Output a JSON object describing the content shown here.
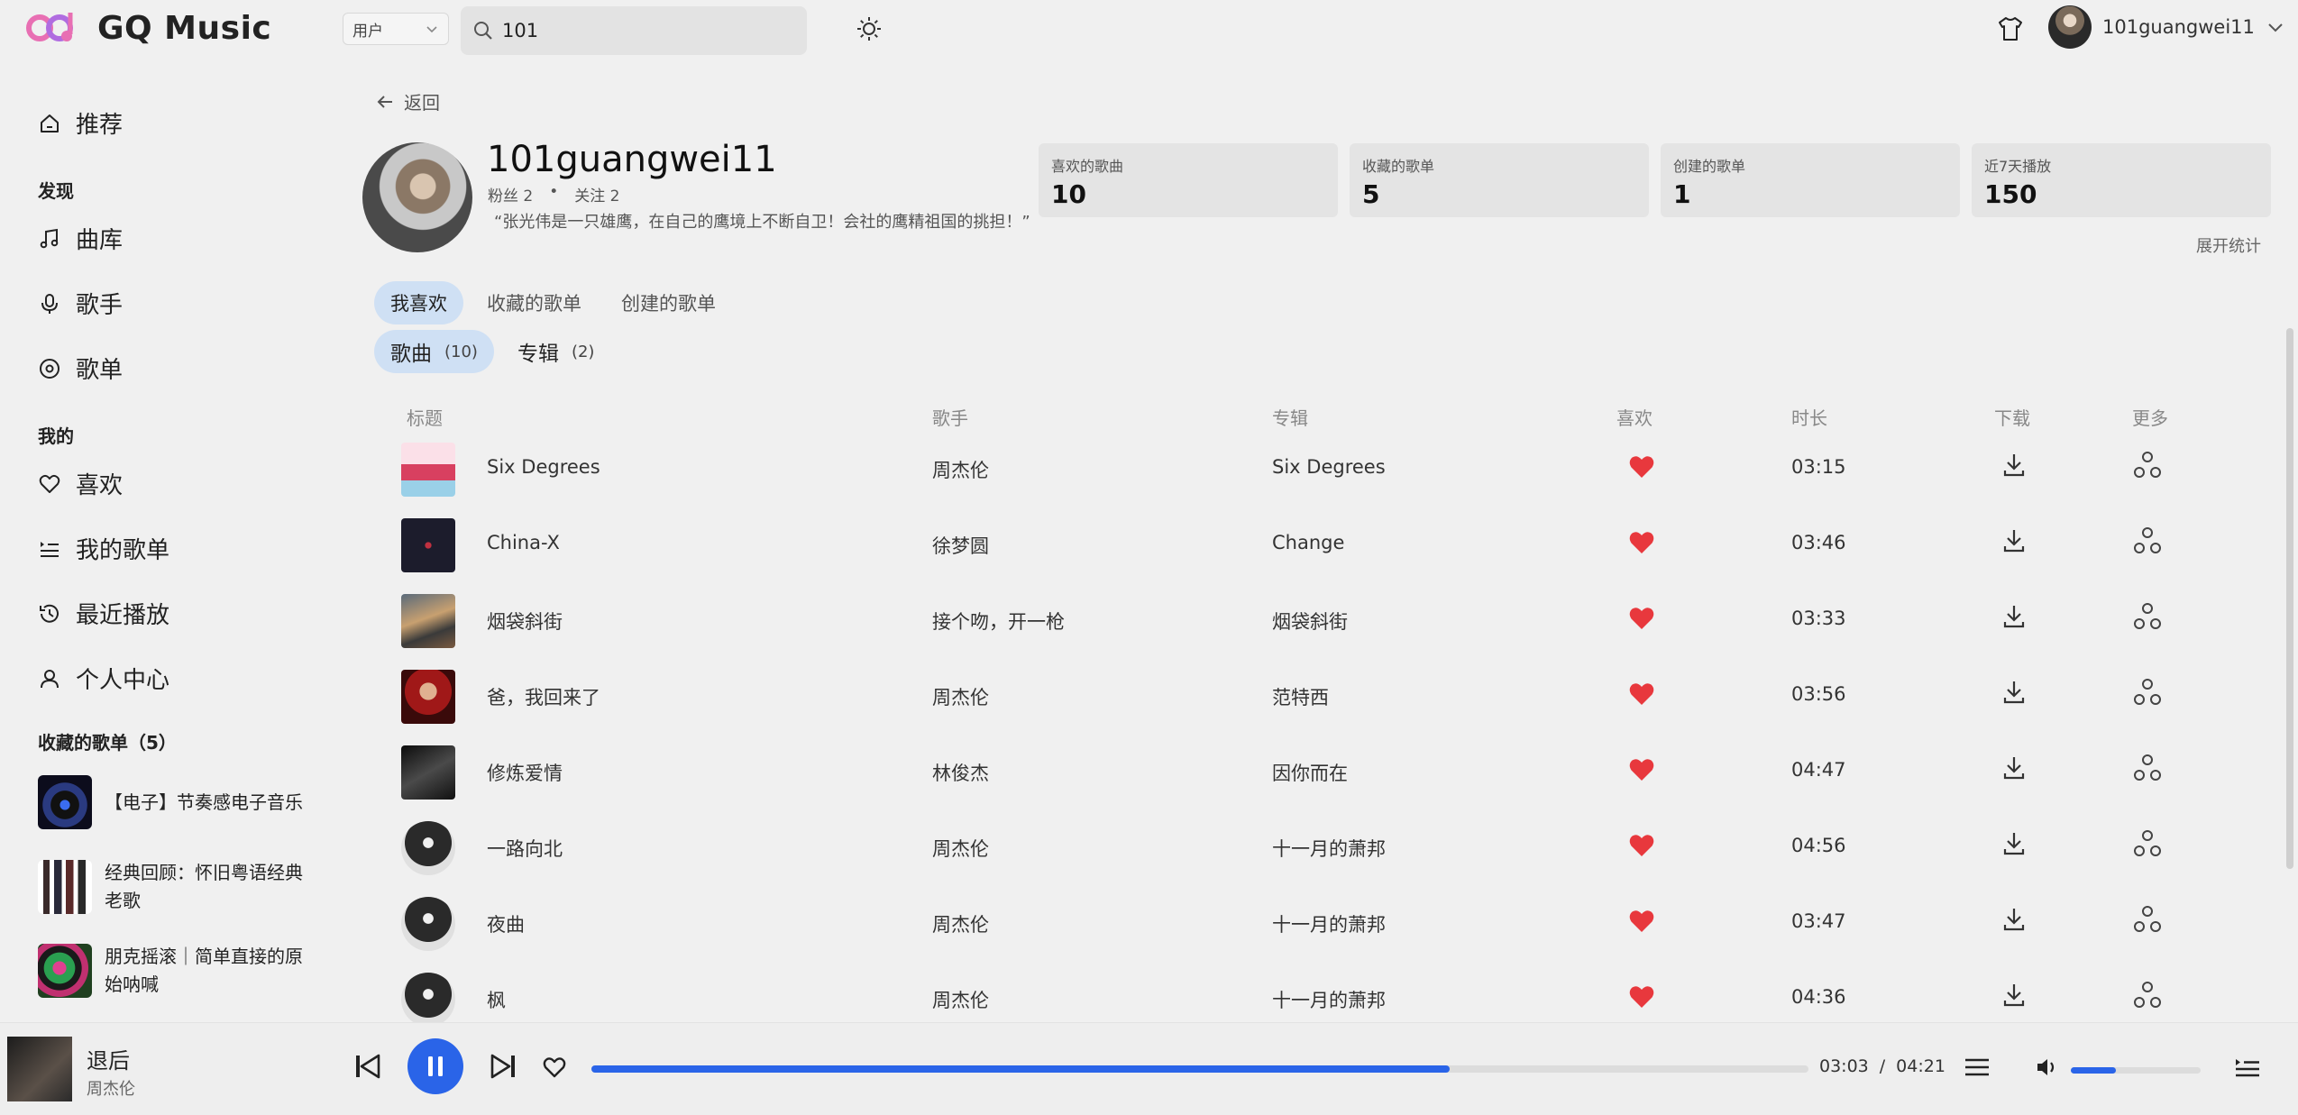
{
  "app": {
    "name": "GQ Music"
  },
  "header": {
    "search_type": "用户",
    "search_value": "101",
    "user_name": "101guangwei11"
  },
  "sidebar": {
    "recommend": "推荐",
    "discover_title": "发现",
    "discover_items": [
      "曲库",
      "歌手",
      "歌单"
    ],
    "mine_title": "我的",
    "mine_items": [
      "喜欢",
      "我的歌单",
      "最近播放",
      "个人中心"
    ],
    "collected_title": "收藏的歌单（5）",
    "collected": [
      {
        "title": "【电子】节奏感电子音乐"
      },
      {
        "title": "经典回顾：怀旧粤语经典老歌"
      },
      {
        "title": "朋克摇滚｜简单直接的原始呐喊"
      }
    ]
  },
  "profile": {
    "back_label": "返回",
    "name": "101guangwei11",
    "fans": "粉丝 2",
    "separator": "•",
    "follows": "关注 2",
    "signature": "“张光伟是一只雄鹰，在自己的鹰境上不断自卫！会社的鹰精祖国的挑担！”",
    "stats": [
      {
        "label": "喜欢的歌曲",
        "value": "10"
      },
      {
        "label": "收藏的歌单",
        "value": "5"
      },
      {
        "label": "创建的歌单",
        "value": "1"
      },
      {
        "label": "近7天播放",
        "value": "150"
      }
    ],
    "expand_stats": "展开统计"
  },
  "tabs": [
    "我喜欢",
    "收藏的歌单",
    "创建的歌单"
  ],
  "subtabs": [
    {
      "label": "歌曲",
      "count": "(10)"
    },
    {
      "label": "专辑",
      "count": "(2)"
    }
  ],
  "table": {
    "headers": {
      "title": "标题",
      "artist": "歌手",
      "album": "专辑",
      "like": "喜欢",
      "duration": "时长",
      "download": "下载",
      "more": "更多"
    },
    "rows": [
      {
        "title": "Six Degrees",
        "artist": "周杰伦",
        "album": "Six Degrees",
        "duration": "03:15"
      },
      {
        "title": "China-X",
        "artist": "徐梦圆",
        "album": "Change",
        "duration": "03:46"
      },
      {
        "title": "烟袋斜街",
        "artist": "接个吻，开一枪",
        "album": "烟袋斜街",
        "duration": "03:33"
      },
      {
        "title": "爸，我回来了",
        "artist": "周杰伦",
        "album": "范特西",
        "duration": "03:56"
      },
      {
        "title": "修炼爱情",
        "artist": "林俊杰",
        "album": "因你而在",
        "duration": "04:47"
      },
      {
        "title": "一路向北",
        "artist": "周杰伦",
        "album": "十一月的萧邦",
        "duration": "04:56"
      },
      {
        "title": "夜曲",
        "artist": "周杰伦",
        "album": "十一月的萧邦",
        "duration": "03:47"
      },
      {
        "title": "枫",
        "artist": "周杰伦",
        "album": "十一月的萧邦",
        "duration": "04:36"
      }
    ]
  },
  "player": {
    "title": "退后",
    "artist": "周杰伦",
    "current_time": "03:03",
    "time_separator": "/",
    "total_time": "04:21",
    "progress": 0.705,
    "volume": 0.35
  },
  "colors": {
    "accent": "#2a64e8",
    "like": "#e8383d",
    "tab_active": "#cfe0f4"
  }
}
